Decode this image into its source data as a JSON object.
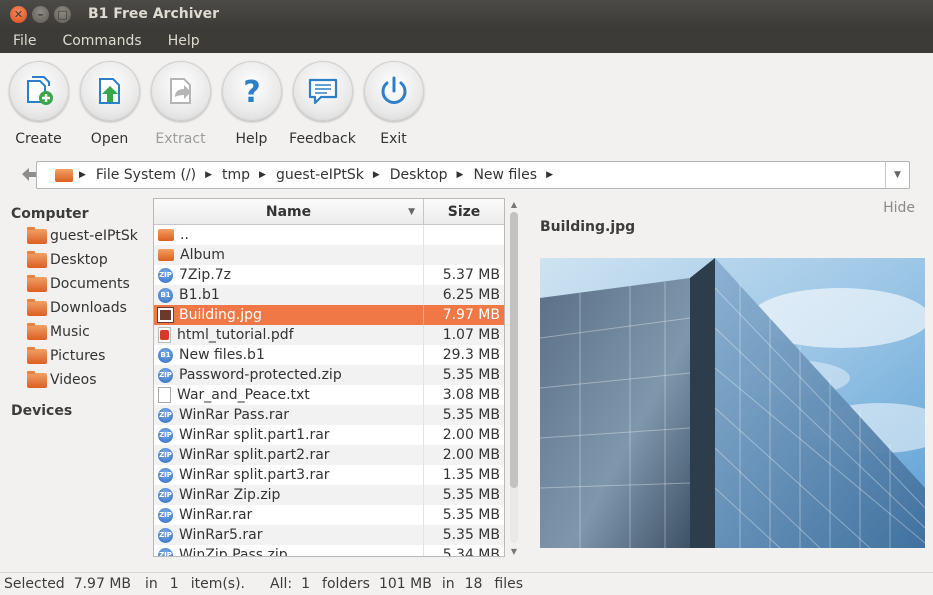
{
  "window": {
    "title": "B1 Free Archiver"
  },
  "menu": [
    {
      "label": "File"
    },
    {
      "label": "Commands"
    },
    {
      "label": "Help"
    }
  ],
  "toolbar": {
    "create": "Create",
    "open": "Open",
    "extract": "Extract",
    "help": "Help",
    "feedback": "Feedback",
    "exit": "Exit"
  },
  "path": [
    "File System (/)",
    "tmp",
    "guest-eIPtSk",
    "Desktop",
    "New files"
  ],
  "sidebar": {
    "computer_label": "Computer",
    "items": [
      {
        "label": "guest-eIPtSk"
      },
      {
        "label": "Desktop"
      },
      {
        "label": "Documents"
      },
      {
        "label": "Downloads"
      },
      {
        "label": "Music"
      },
      {
        "label": "Pictures"
      },
      {
        "label": "Videos"
      }
    ],
    "devices_label": "Devices"
  },
  "filelist": {
    "col_name": "Name",
    "col_size": "Size",
    "rows": [
      {
        "name": "..",
        "size": "",
        "icon": "folder-icon"
      },
      {
        "name": "Album",
        "size": "",
        "icon": "folder-icon"
      },
      {
        "name": "7Zip.7z",
        "size": "5.37 MB",
        "icon": "archive-icon"
      },
      {
        "name": "B1.b1",
        "size": "6.25 MB",
        "icon": "b1-archive-icon"
      },
      {
        "name": "Building.jpg",
        "size": "7.97 MB",
        "icon": "image-icon",
        "selected": true
      },
      {
        "name": "html_tutorial.pdf",
        "size": "1.07 MB",
        "icon": "pdf-icon"
      },
      {
        "name": "New files.b1",
        "size": "29.3 MB",
        "icon": "b1-archive-icon"
      },
      {
        "name": "Password-protected.zip",
        "size": "5.35 MB",
        "icon": "archive-icon"
      },
      {
        "name": "War_and_Peace.txt",
        "size": "3.08 MB",
        "icon": "text-file-icon"
      },
      {
        "name": "WinRar Pass.rar",
        "size": "5.35 MB",
        "icon": "archive-icon"
      },
      {
        "name": "WinRar split.part1.rar",
        "size": "2.00 MB",
        "icon": "archive-icon"
      },
      {
        "name": "WinRar split.part2.rar",
        "size": "2.00 MB",
        "icon": "archive-icon"
      },
      {
        "name": "WinRar split.part3.rar",
        "size": "1.35 MB",
        "icon": "archive-icon"
      },
      {
        "name": "WinRar Zip.zip",
        "size": "5.35 MB",
        "icon": "archive-icon"
      },
      {
        "name": "WinRar.rar",
        "size": "5.35 MB",
        "icon": "archive-icon"
      },
      {
        "name": "WinRar5.rar",
        "size": "5.35 MB",
        "icon": "archive-icon"
      },
      {
        "name": "WinZip Pass.zip",
        "size": "5.34 MB",
        "icon": "archive-icon"
      }
    ]
  },
  "preview": {
    "hide_label": "Hide",
    "title": "Building.jpg"
  },
  "status": {
    "selected_label": "Selected",
    "selected_size": "7.97 MB",
    "in1": "in",
    "selected_count": "1",
    "items_label": "item(s).",
    "all_label": "All:",
    "folders_count": "1",
    "folders_label": "folders",
    "total_size": "101 MB",
    "in2": "in",
    "files_count": "18",
    "files_label": "files"
  },
  "colors": {
    "accent": "#f07746",
    "titlebar": "#3c3b37",
    "close": "#dc4d1b"
  }
}
